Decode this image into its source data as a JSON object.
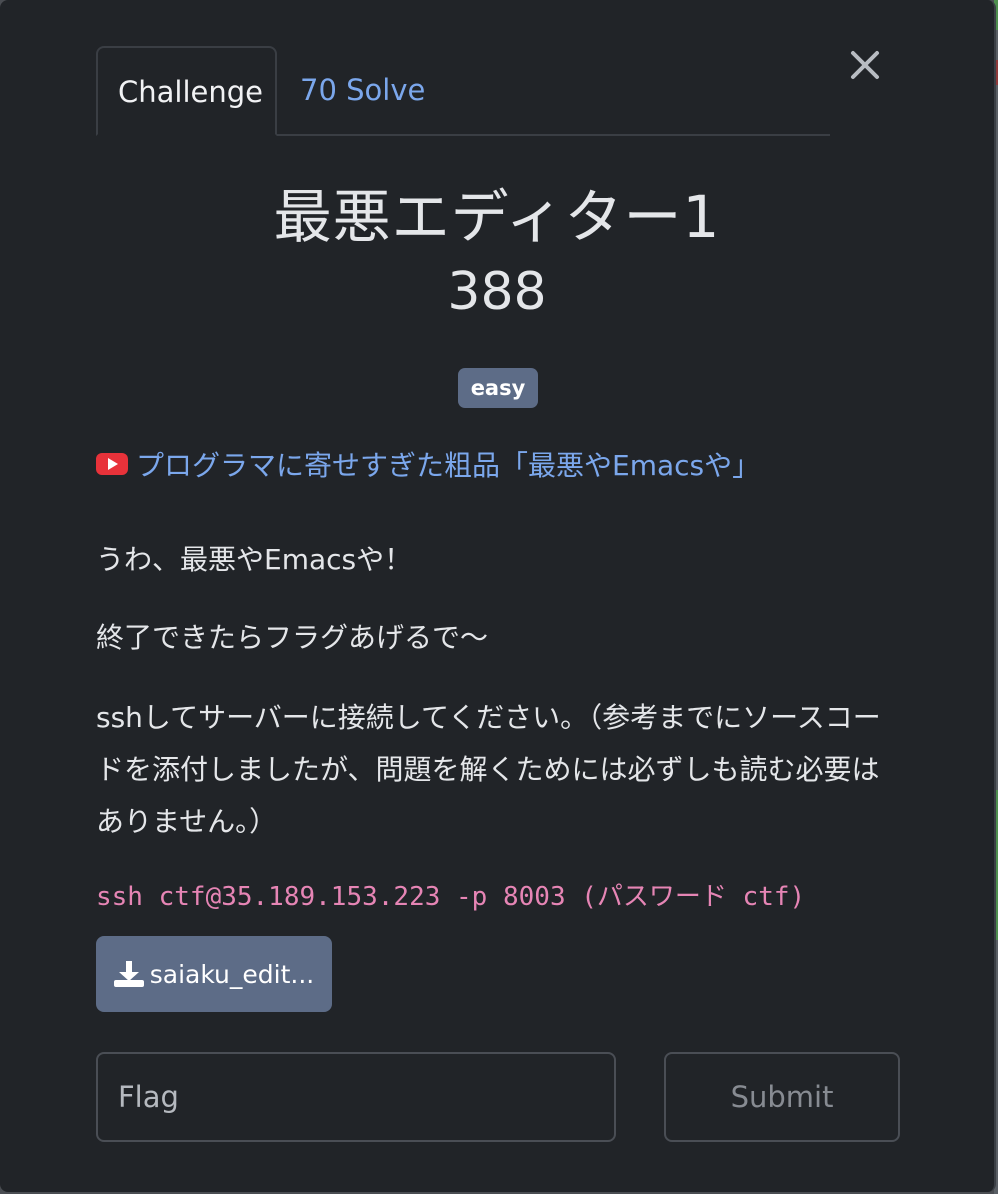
{
  "tabs": [
    {
      "label": "Challenge",
      "active": true
    },
    {
      "label": "70 Solve",
      "active": false
    }
  ],
  "challenge": {
    "title": "最悪エディター1",
    "points": "388",
    "difficulty": "easy",
    "video_link": "プログラマに寄せすぎた粗品「最悪やEmacsや」",
    "description": [
      "うわ、最悪やEmacsや！",
      "終了できたらフラグあげるで〜",
      "sshしてサーバーに接続してください。（参考までにソースコードを添付しましたが、問題を解くためには必ずしも読む必要はありません。）"
    ],
    "command": "ssh ctf@35.189.153.223 -p 8003 (パスワード ctf)",
    "attachment": "saiaku_edit..."
  },
  "form": {
    "flag_placeholder": "Flag",
    "flag_value": "",
    "submit_label": "Submit"
  },
  "colors": {
    "background": "#212428",
    "link": "#7ba7ec",
    "badge": "#5d6c87",
    "code": "#e685b5",
    "youtube": "#e8323a"
  }
}
